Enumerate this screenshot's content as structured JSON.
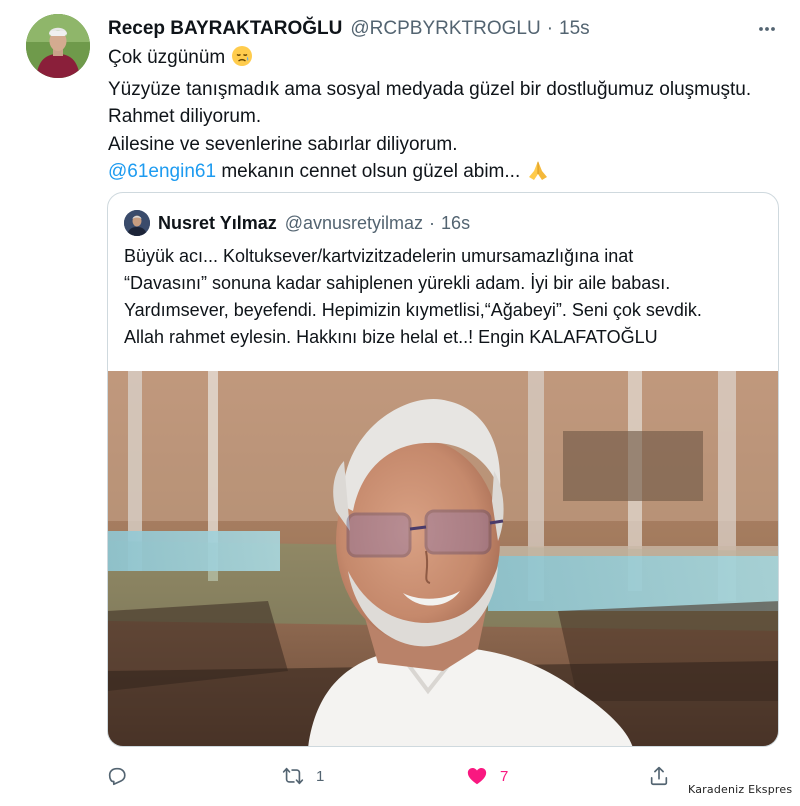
{
  "tweet": {
    "author": {
      "name": "Recep BAYRAKTAROĞLU",
      "handle": "@RCPBYRKTROGLU",
      "separator": "·",
      "time": "15s"
    },
    "lines": [
      "Çok üzgünüm",
      "Yüzyüze tanışmadık ama sosyal medyada güzel bir dostluğumuz oluşmuştu.",
      "Rahmet diliyorum.",
      "Ailesine ve sevenlerine sabırlar diliyorum."
    ],
    "mention": "@61engin61",
    "last_line": "mekanın cennet olsun güzel abim...",
    "emojis": {
      "first": "sad-face-emoji",
      "last": "folded-hands-emoji"
    }
  },
  "quoted": {
    "author": {
      "name": "Nusret Yılmaz",
      "handle": "@avnusretyilmaz",
      "separator": "·",
      "time": "16s"
    },
    "lines": [
      "Büyük acı... Koltuksever/kartvizitzadelerin umursamazlığına inat",
      "“Davasını” sonuna kadar sahiplenen yürekli adam. İyi bir aile babası.",
      "Yardımsever, beyefendi. Hepimizin kıymetlisi,“Ağabeyi”. Seni çok sevdik.",
      "Allah rahmet eylesin. Hakkını bize helal et..!   Engin KALAFATOĞLU"
    ]
  },
  "actions": {
    "reply": {
      "icon": "reply-icon",
      "count": ""
    },
    "retweet": {
      "icon": "retweet-icon",
      "count": "1"
    },
    "like": {
      "icon": "heart-icon",
      "count": "7",
      "color": "#f91880"
    },
    "share": {
      "icon": "share-icon"
    }
  },
  "watermark": "Karadeniz Ekspres",
  "colors": {
    "link": "#1d9bf0",
    "secondary_text": "#536471",
    "border": "#cfd9de",
    "like": "#f91880"
  }
}
